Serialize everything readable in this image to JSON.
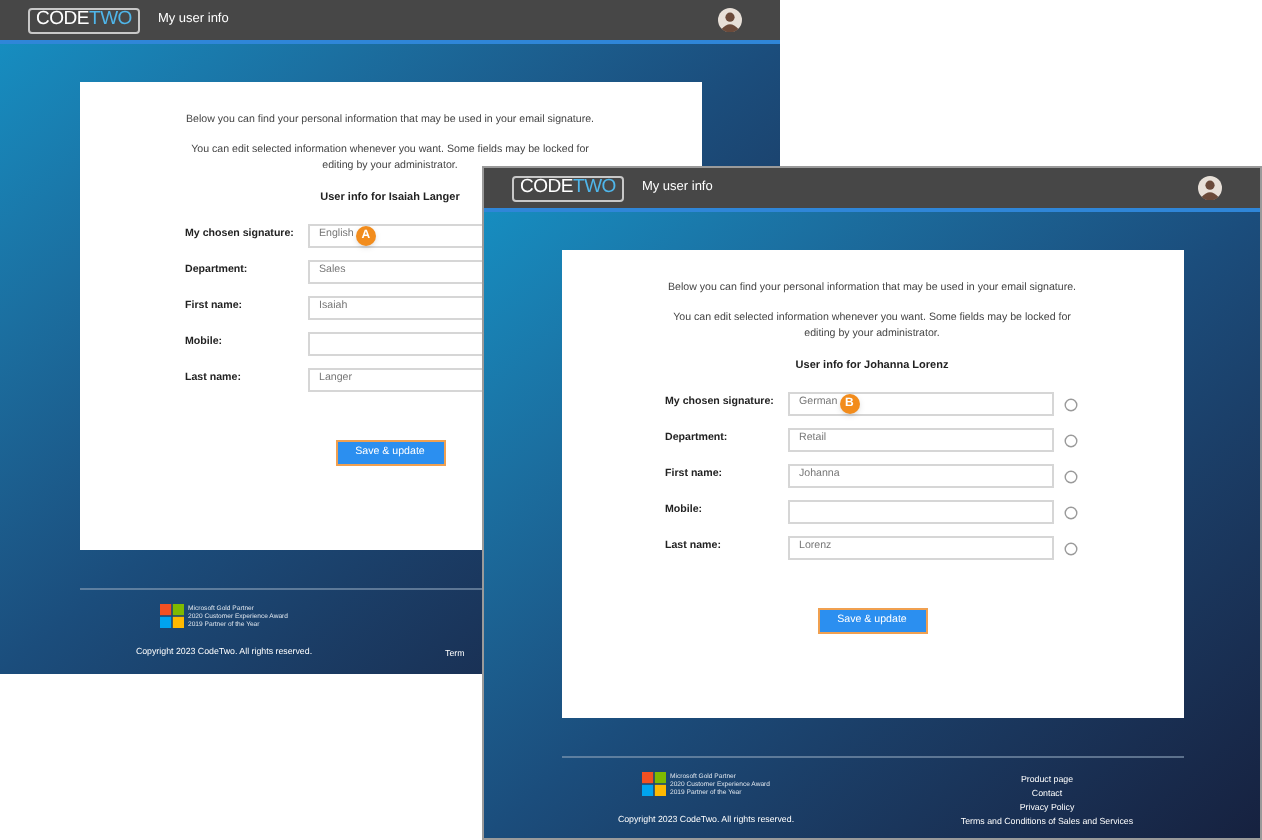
{
  "windows": [
    {
      "kind": "back",
      "header": {
        "logo_left": "CODE",
        "logo_right": "TWO",
        "title": "My user info"
      },
      "intro": "Below you can find your personal information that may be used in your email signature.",
      "note": "You can edit selected information whenever you want. Some fields may be locked for editing by your administrator.",
      "heading": "User info for Isaiah Langer",
      "fields": [
        {
          "label": "My chosen signature:",
          "value": "English",
          "badge": "A"
        },
        {
          "label": "Department:",
          "value": "Sales"
        },
        {
          "label": "First name:",
          "value": "Isaiah"
        },
        {
          "label": "Mobile:"
        },
        {
          "label": "Last name:",
          "value": "Langer"
        }
      ],
      "button": "Save & update",
      "footer": {
        "partner_lines": [
          "Microsoft Gold Partner",
          "2020 Customer Experience Award",
          "2019 Partner of the Year"
        ],
        "copyright": "Copyright 2023 CodeTwo. All rights reserved.",
        "links": [
          "Term"
        ]
      }
    },
    {
      "kind": "front",
      "header": {
        "logo_left": "CODE",
        "logo_right": "TWO",
        "title": "My user info"
      },
      "intro": "Below you can find your personal information that may be used in your email signature.",
      "note": "You can edit selected information whenever you want. Some fields may be locked for editing by your administrator.",
      "heading": "User info for Johanna Lorenz",
      "fields": [
        {
          "label": "My chosen signature:",
          "value": "German",
          "badge": "B"
        },
        {
          "label": "Department:",
          "value": "Retail"
        },
        {
          "label": "First name:",
          "value": "Johanna"
        },
        {
          "label": "Mobile:"
        },
        {
          "label": "Last name:",
          "value": "Lorenz"
        }
      ],
      "button": "Save & update",
      "footer": {
        "partner_lines": [
          "Microsoft Gold Partner",
          "2020 Customer Experience Award",
          "2019 Partner of the Year"
        ],
        "copyright": "Copyright 2023 CodeTwo. All rights reserved.",
        "links": [
          "Product page",
          "Contact",
          "Privacy Policy",
          "Terms and Conditions of Sales and Services"
        ]
      }
    }
  ]
}
